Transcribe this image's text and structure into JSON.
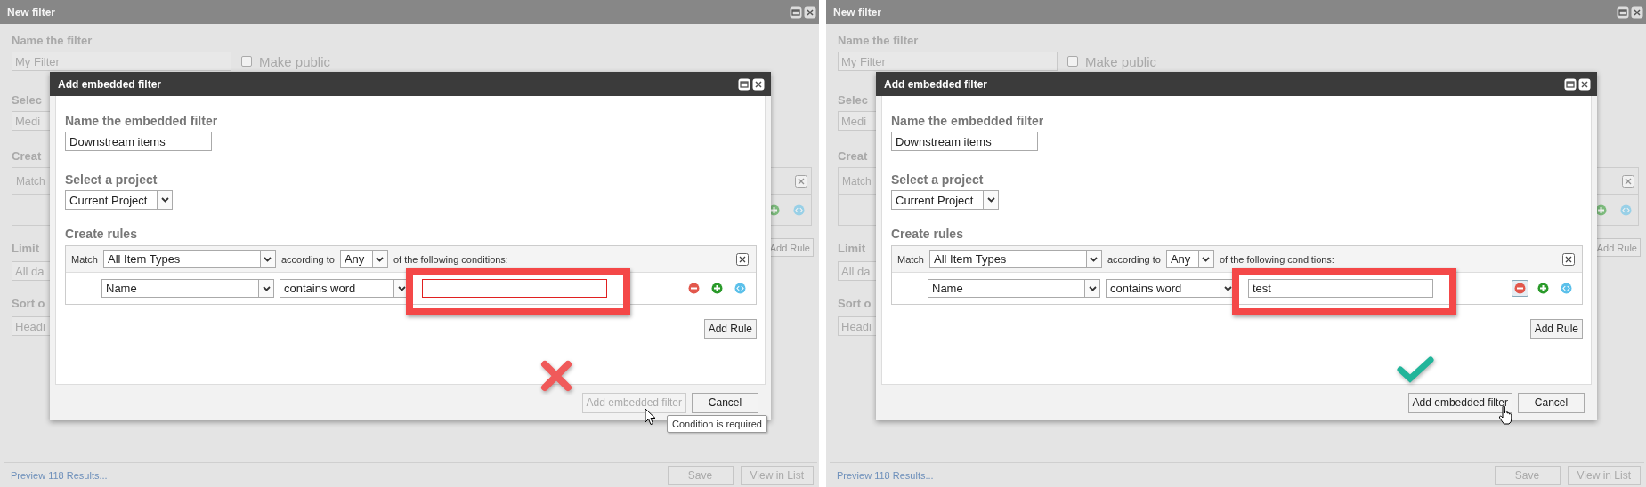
{
  "panels": [
    {
      "window": {
        "title": "New filter",
        "name_label": "Name the filter",
        "name_value": "My Filter",
        "make_public": {
          "label": "Make public",
          "checked": false
        },
        "project_label": "Selec",
        "project_value": "Medi",
        "rules_label": "Creat",
        "match_label": "Match",
        "add_rule": "Add Rule",
        "limit_label": "Limit",
        "limit_value": "All da",
        "sort_label": "Sort o",
        "sort_value": "Headi",
        "preview_link": "Preview 118 Results...",
        "buttons": [
          "Save",
          "View in List"
        ]
      },
      "dialog": {
        "title": "Add embedded filter",
        "name_label": "Name the embedded filter",
        "name_value": "Downstream items",
        "project_label": "Select a project",
        "project_value": "Current Project",
        "rules_label": "Create rules",
        "match_label": "Match",
        "item_type": "All Item Types",
        "according_label": "according to",
        "quantifier": "Any",
        "conditions_label": "of the following conditions:",
        "rule": {
          "field": "Name",
          "operator": "contains word",
          "invalid": true,
          "remove_hovered": false
        },
        "add_rule": "Add Rule",
        "buttons": [
          {
            "label": "Add embedded filter",
            "disabled": true
          },
          {
            "label": "Cancel",
            "disabled": false
          }
        ],
        "tooltip": "Condition is required"
      },
      "annotation": {
        "kind": "cross"
      },
      "cursor": {
        "kind": "arrow"
      }
    },
    {
      "window": {
        "title": "New filter",
        "name_label": "Name the filter",
        "name_value": "My Filter",
        "make_public": {
          "label": "Make public",
          "checked": false
        },
        "project_label": "Selec",
        "project_value": "Medi",
        "rules_label": "Creat",
        "match_label": "Match",
        "add_rule": "Add Rule",
        "limit_label": "Limit",
        "limit_value": "All da",
        "sort_label": "Sort o",
        "sort_value": "Headi",
        "preview_link": "Preview 118 Results...",
        "buttons": [
          "Save",
          "View in List"
        ]
      },
      "dialog": {
        "title": "Add embedded filter",
        "name_label": "Name the embedded filter",
        "name_value": "Downstream items",
        "project_label": "Select a project",
        "project_value": "Current Project",
        "rules_label": "Create rules",
        "match_label": "Match",
        "item_type": "All Item Types",
        "according_label": "according to",
        "quantifier": "Any",
        "conditions_label": "of the following conditions:",
        "rule": {
          "field": "Name",
          "operator": "contains word",
          "value": "test",
          "invalid": false,
          "remove_hovered": true
        },
        "add_rule": "Add Rule",
        "buttons": [
          {
            "label": "Add embedded filter",
            "disabled": false
          },
          {
            "label": "Cancel",
            "disabled": false
          }
        ]
      },
      "annotation": {
        "kind": "check"
      },
      "cursor": {
        "kind": "hand"
      }
    }
  ]
}
